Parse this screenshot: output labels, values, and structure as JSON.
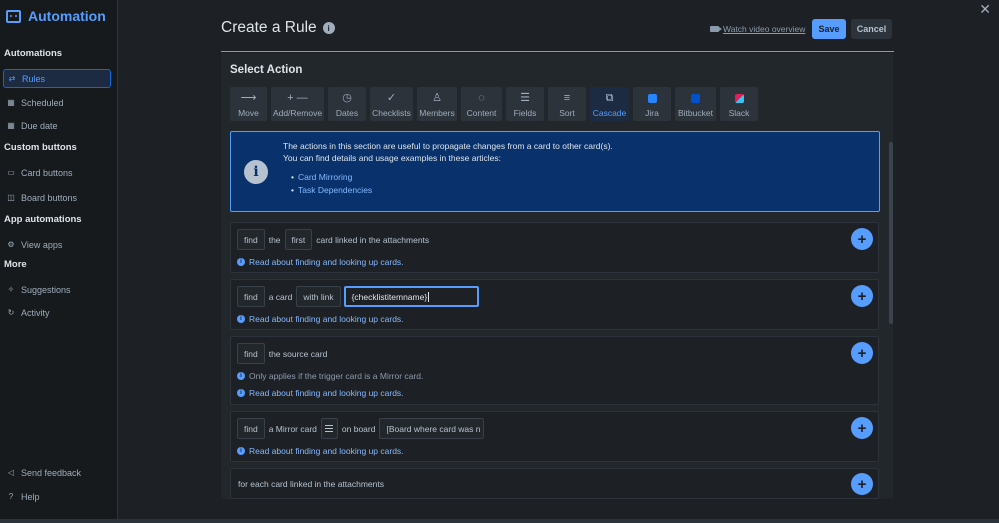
{
  "sidebar": {
    "title": "Automation",
    "sections": {
      "automations": "Automations",
      "custom_buttons": "Custom buttons",
      "app_automations": "App automations",
      "more": "More"
    },
    "items": {
      "rules": "Rules",
      "scheduled": "Scheduled",
      "due_date": "Due date",
      "card_buttons": "Card buttons",
      "board_buttons": "Board buttons",
      "view_apps": "View apps",
      "suggestions": "Suggestions",
      "activity": "Activity",
      "send_feedback": "Send feedback",
      "help": "Help"
    }
  },
  "header": {
    "title": "Create a Rule",
    "watch_video": "Watch video overview",
    "save": "Save",
    "cancel": "Cancel"
  },
  "select_action": {
    "title": "Select Action",
    "tabs": [
      "Move",
      "Add/Remove",
      "Dates",
      "Checklists",
      "Members",
      "Content",
      "Fields",
      "Sort",
      "Cascade",
      "Jira",
      "Bitbucket",
      "Slack"
    ],
    "active_tab": "Cascade"
  },
  "info": {
    "line1": "The actions in this section are useful to propagate changes from a card to other card(s).",
    "line2": "You can find details and usage examples in these articles:",
    "links": [
      "Card Mirroring",
      "Task Dependencies"
    ]
  },
  "rows": {
    "r1": {
      "find": "find",
      "the": "the",
      "first": "first",
      "rest": "card linked in the attachments",
      "link": "Read about finding and looking up cards."
    },
    "r2": {
      "find": "find",
      "a_card": "a card",
      "with_link": "with link",
      "value": "{checklistitemname}",
      "link": "Read about finding and looking up cards."
    },
    "r3": {
      "find": "find",
      "rest": "the source card",
      "note": "Only applies if the trigger card is a Mirror card.",
      "link": "Read about finding and looking up cards."
    },
    "r4": {
      "find": "find",
      "mirror": "a Mirror card",
      "on_board": "on board",
      "board_value": "[Board where card was n",
      "link": "Read about finding and looking up cards."
    },
    "r5": {
      "text": "for each card linked in the attachments"
    }
  },
  "colors": {
    "accent": "#579dff",
    "jira": "#2684ff",
    "bitbucket": "#0052cc",
    "slack": "#4a154b"
  }
}
